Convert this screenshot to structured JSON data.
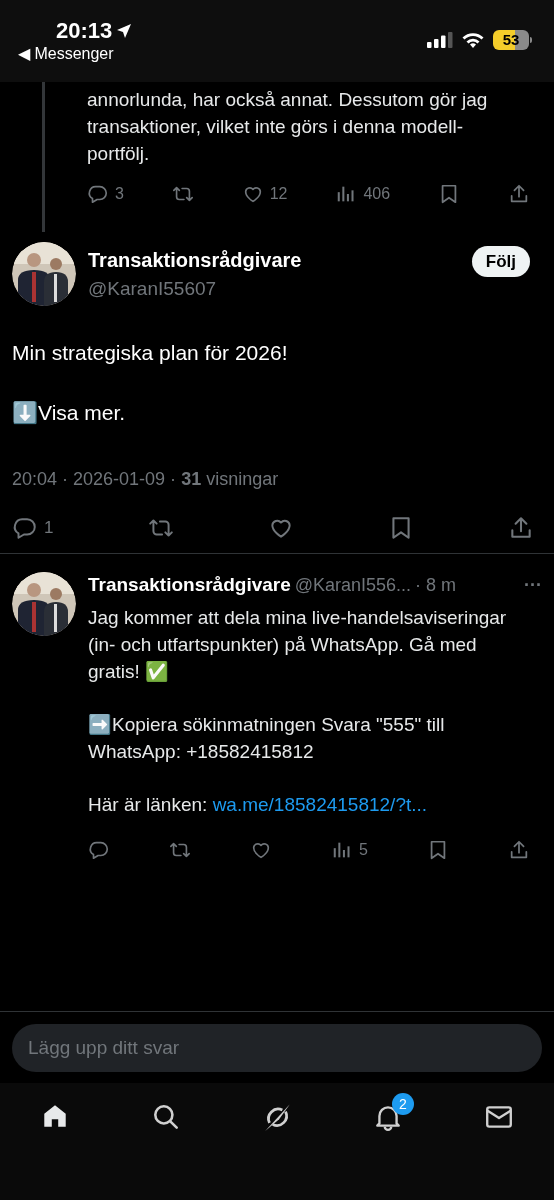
{
  "status_bar": {
    "time": "20:13",
    "back_app": "◀ Messenger",
    "battery": "53"
  },
  "parent_post": {
    "text_lines": [
      "annorlunda, har också annat. Dessutom gör jag",
      "transaktioner, vilket inte görs i denna modell-",
      "portfölj."
    ],
    "actions": [
      {
        "kind": "reply",
        "count": "3"
      },
      {
        "kind": "repost"
      },
      {
        "kind": "like",
        "count": "12"
      },
      {
        "kind": "views",
        "count": "406"
      },
      {
        "kind": "bookmark"
      },
      {
        "kind": "share"
      }
    ]
  },
  "main_post": {
    "name": "Transaktionsrådgivare",
    "handle": "@KaranI55607",
    "follow": "Följ",
    "paragraphs": [
      "Min strategiska plan för 2026!",
      "⬇️Visa mer."
    ],
    "meta": "20:04 · 2026-01-09 · **31** visningar",
    "actions": [
      {
        "kind": "reply",
        "count": "1"
      },
      {
        "kind": "repost"
      },
      {
        "kind": "like"
      },
      {
        "kind": "bookmark"
      },
      {
        "kind": "share"
      }
    ]
  },
  "reply": {
    "name": "Transaktionsrådgivare",
    "handle": "@KaranI556...",
    "time": "· 8 m",
    "more": "···",
    "paragraphs": [
      {
        "text": "Jag kommer att dela mina live-handelsaviseringar (in- och utfartspunkter) på WhatsApp. Gå med gratis! ✅"
      },
      {
        "text": "➡️Kopiera sökinmatningen Svara \"555\" till WhatsApp: +18582415812"
      },
      {
        "text": "Här är länken: ",
        "link": "wa.me/18582415812/?t..."
      }
    ],
    "actions": [
      {
        "kind": "reply"
      },
      {
        "kind": "repost"
      },
      {
        "kind": "like"
      },
      {
        "kind": "views",
        "count": "5"
      },
      {
        "kind": "bookmark"
      },
      {
        "kind": "share"
      }
    ]
  },
  "reply_field": {
    "placeholder": "Lägg upp ditt svar"
  },
  "tab_bar": [
    {
      "kind": "home",
      "selected": true
    },
    {
      "kind": "search",
      "selected": false
    },
    {
      "kind": "grok",
      "selected": false
    },
    {
      "kind": "notifications",
      "selected": false,
      "badge": "2"
    },
    {
      "kind": "messages",
      "selected": false
    }
  ]
}
